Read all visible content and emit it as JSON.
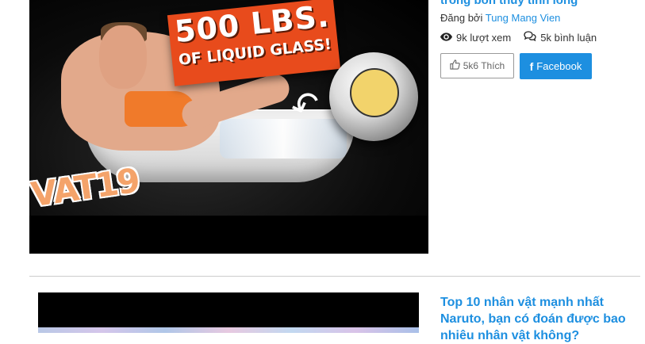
{
  "post1": {
    "title": "trong bồn thủy tinh lỏng",
    "thumbnail": {
      "banner_line1": "500 LBS.",
      "banner_line2": "OF LIQUID GLASS!",
      "logo_text": "VAT19"
    },
    "author_prefix": "Đăng bởi",
    "author_name": "Tung Mang Vien",
    "views": "9k lượt xem",
    "comments": "5k bình luận",
    "like_label": "5k6 Thích",
    "facebook_label": "Facebook"
  },
  "post2": {
    "title": "Top 10 nhân vật mạnh nhất Naruto, bạn có đoán được bao nhiêu nhân vật không?"
  },
  "colors": {
    "accent": "#1d8fe0",
    "divider": "#cccccc"
  },
  "icons": {
    "views": "eye-icon",
    "comments": "comments-icon",
    "like": "thumbs-up-icon",
    "facebook": "facebook-icon"
  }
}
